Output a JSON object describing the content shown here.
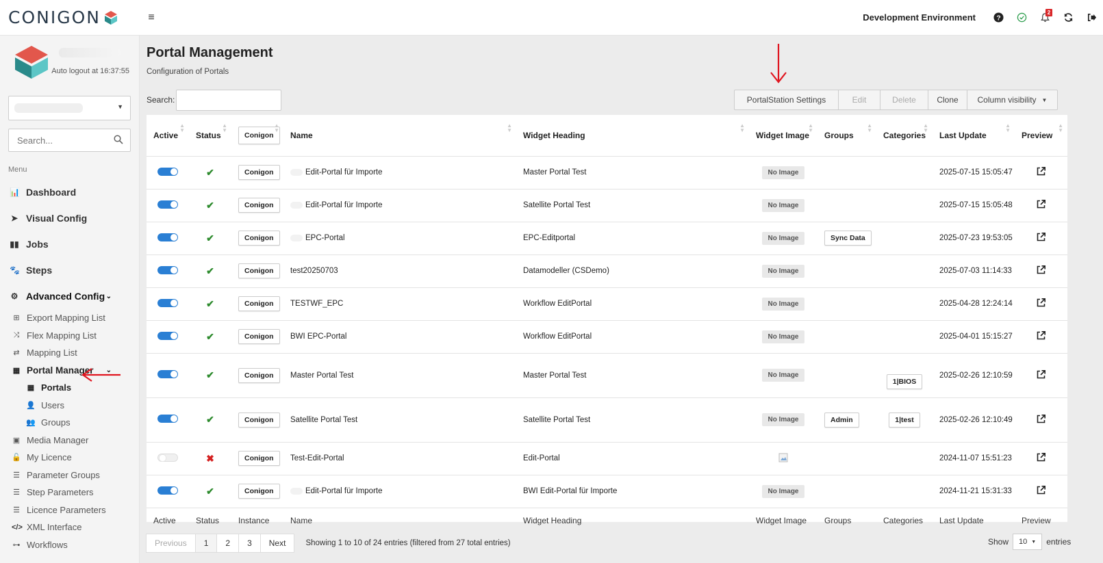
{
  "brand": {
    "name": "CONIGON"
  },
  "header": {
    "environment": "Development Environment",
    "notification_count": "2"
  },
  "sidebar": {
    "auto_logout": "Auto logout at 16:37:55",
    "search_placeholder": "Search...",
    "menu_header": "Menu",
    "items": [
      {
        "label": "Dashboard"
      },
      {
        "label": "Visual Config"
      },
      {
        "label": "Jobs"
      },
      {
        "label": "Steps"
      },
      {
        "label": "Advanced Config"
      }
    ],
    "sub_items": [
      {
        "label": "Export Mapping List"
      },
      {
        "label": "Flex Mapping List"
      },
      {
        "label": "Mapping List"
      },
      {
        "label": "Portal Manager"
      }
    ],
    "portal_items": [
      {
        "label": "Portals"
      },
      {
        "label": "Users"
      },
      {
        "label": "Groups"
      }
    ],
    "bottom_items": [
      {
        "label": "Media Manager"
      },
      {
        "label": "My Licence"
      },
      {
        "label": "Parameter Groups"
      },
      {
        "label": "Step Parameters"
      },
      {
        "label": "Licence Parameters"
      },
      {
        "label": "XML Interface"
      },
      {
        "label": "Workflows"
      }
    ]
  },
  "page": {
    "title": "Portal Management",
    "subtitle": "Configuration of Portals",
    "search_label": "Search:"
  },
  "toolbar": {
    "portalstation_settings": "PortalStation Settings",
    "edit": "Edit",
    "delete": "Delete",
    "clone": "Clone",
    "column_visibility": "Column visibility"
  },
  "table": {
    "headers": {
      "active": "Active",
      "status": "Status",
      "instance_filter": "Conigon",
      "name": "Name",
      "widget_heading": "Widget Heading",
      "widget_image": "Widget Image",
      "groups": "Groups",
      "categories": "Categories",
      "last_update": "Last Update",
      "preview": "Preview"
    },
    "footer": {
      "active": "Active",
      "status": "Status",
      "instance": "Instance",
      "name": "Name",
      "widget_heading": "Widget Heading",
      "widget_image": "Widget Image",
      "groups": "Groups",
      "categories": "Categories",
      "last_update": "Last Update",
      "preview": "Preview"
    },
    "rows": [
      {
        "instance": "Conigon",
        "name": "Edit-Portal für Importe",
        "heading": "Master Portal Test",
        "image": "No Image",
        "group": "",
        "category": "",
        "updated": "2025-07-15 15:05:47"
      },
      {
        "instance": "Conigon",
        "name": "Edit-Portal für Importe",
        "heading": "Satellite Portal Test",
        "image": "No Image",
        "group": "",
        "category": "",
        "updated": "2025-07-15 15:05:48"
      },
      {
        "instance": "Conigon",
        "name": "EPC-Portal",
        "heading": "EPC-Editportal",
        "image": "No Image",
        "group": "Sync Data",
        "category": "",
        "updated": "2025-07-23 19:53:05"
      },
      {
        "instance": "Conigon",
        "name": "test20250703",
        "heading": "Datamodeller (CSDemo)",
        "image": "No Image",
        "group": "",
        "category": "",
        "updated": "2025-07-03 11:14:33"
      },
      {
        "instance": "Conigon",
        "name": "TESTWF_EPC",
        "heading": "Workflow EditPortal",
        "image": "No Image",
        "group": "",
        "category": "",
        "updated": "2025-04-28 12:24:14"
      },
      {
        "instance": "Conigon",
        "name": "BWI EPC-Portal",
        "heading": "Workflow EditPortal",
        "image": "No Image",
        "group": "",
        "category": "",
        "updated": "2025-04-01 15:15:27"
      },
      {
        "instance": "Conigon",
        "name": "Master Portal Test",
        "heading": "Master Portal Test",
        "image": "No Image",
        "group": "",
        "category": "1|BIOS",
        "updated": "2025-02-26 12:10:59"
      },
      {
        "instance": "Conigon",
        "name": "Satellite Portal Test",
        "heading": "Satellite Portal Test",
        "image": "No Image",
        "group": "Admin",
        "category": "1|test",
        "updated": "2025-02-26 12:10:49"
      },
      {
        "instance": "Conigon",
        "name": "Test-Edit-Portal",
        "heading": "Edit-Portal",
        "image": "",
        "group": "",
        "category": "",
        "updated": "2024-11-07 15:51:23"
      },
      {
        "instance": "Conigon",
        "name": "Edit-Portal für Importe",
        "heading": "BWI Edit-Portal für Importe",
        "image": "No Image",
        "group": "",
        "category": "",
        "updated": "2024-11-21 15:31:33"
      }
    ]
  },
  "pagination": {
    "previous": "Previous",
    "pages": [
      "1",
      "2",
      "3"
    ],
    "next": "Next",
    "info": "Showing 1 to 10 of 24 entries (filtered from 27 total entries)",
    "show_label": "Show",
    "page_size": "10",
    "entries_label": "entries"
  },
  "colors": {
    "toggle_on": "#2a7fd4",
    "check": "#2e8b2e",
    "cross": "#d42020",
    "annotation_arrow": "#e0141e"
  },
  "row_states": [
    {
      "active": true,
      "ok": true
    },
    {
      "active": true,
      "ok": true
    },
    {
      "active": true,
      "ok": true
    },
    {
      "active": true,
      "ok": true
    },
    {
      "active": true,
      "ok": true
    },
    {
      "active": true,
      "ok": true
    },
    {
      "active": true,
      "ok": true
    },
    {
      "active": true,
      "ok": true
    },
    {
      "active": false,
      "ok": false
    },
    {
      "active": true,
      "ok": true
    }
  ]
}
